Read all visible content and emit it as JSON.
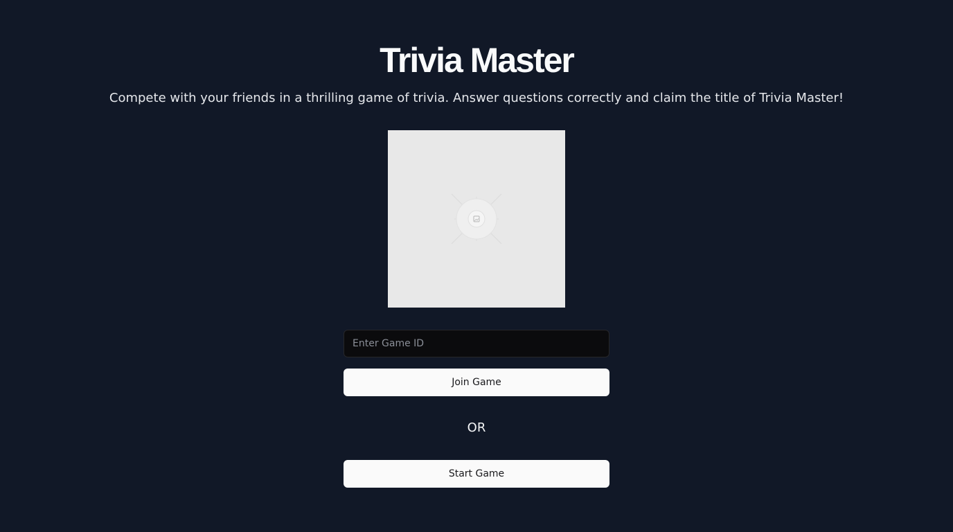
{
  "header": {
    "title": "Trivia Master",
    "subtitle": "Compete with your friends in a thrilling game of trivia. Answer questions correctly and claim the title of Trivia Master!"
  },
  "hero_image": {
    "icon": "image-placeholder-icon"
  },
  "join": {
    "input_value": "",
    "input_placeholder": "Enter Game ID",
    "button_label": "Join Game"
  },
  "divider": {
    "text": "OR"
  },
  "start": {
    "button_label": "Start Game"
  },
  "colors": {
    "background": "#111827",
    "button_bg": "#fafafa",
    "input_bg": "#0b0b0d",
    "placeholder_bg": "#e8e8e8"
  }
}
